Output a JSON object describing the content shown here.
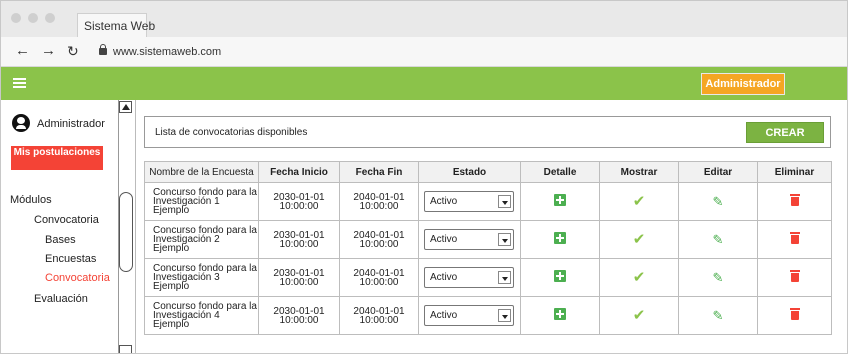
{
  "browser": {
    "tab_title": "Sistema Web",
    "url": "www.sistemaweb.com"
  },
  "header": {
    "admin_button": "Administrador"
  },
  "sidebar": {
    "user_name": "Administrador",
    "mis_postulaciones": "Mis postulaciones",
    "menu": {
      "modulos": "Módulos",
      "convocatoria": "Convocatoria",
      "bases": "Bases",
      "encuestas": "Encuestas",
      "convocatoria_active": "Convocatoria",
      "evaluacion": "Evaluación"
    }
  },
  "panel": {
    "title": "Lista de convocatorias disponibles",
    "crear_label": "CREAR"
  },
  "table": {
    "headers": [
      "Nombre de la Encuesta",
      "Fecha Inicio",
      "Fecha Fin",
      "Estado",
      "Detalle",
      "Mostrar",
      "Editar",
      "Eliminar"
    ],
    "rows": [
      {
        "name1": "Concurso fondo para la",
        "name2": "Investigación 1 Ejemplo",
        "inicio1": "2030-01-01",
        "inicio2": "10:00:00",
        "fin1": "2040-01-01",
        "fin2": "10:00:00",
        "estado": "Activo"
      },
      {
        "name1": "Concurso fondo para la",
        "name2": "Investigación 2 Ejemplo",
        "inicio1": "2030-01-01",
        "inicio2": "10:00:00",
        "fin1": "2040-01-01",
        "fin2": "10:00:00",
        "estado": "Activo"
      },
      {
        "name1": "Concurso fondo para la",
        "name2": "Investigación 3 Ejemplo",
        "inicio1": "2030-01-01",
        "inicio2": "10:00:00",
        "fin1": "2040-01-01",
        "fin2": "10:00:00",
        "estado": "Activo"
      },
      {
        "name1": "Concurso fondo para la",
        "name2": "Investigación 4 Ejemplo",
        "inicio1": "2030-01-01",
        "inicio2": "10:00:00",
        "fin1": "2040-01-01",
        "fin2": "10:00:00",
        "estado": "Activo"
      }
    ]
  },
  "colors": {
    "header_green": "#8bc34a",
    "admin_orange": "#f5a623",
    "danger_red": "#f44336",
    "crear_green": "#7cb342"
  },
  "icons": {
    "detalle": "add-box-icon",
    "mostrar": "check-icon",
    "editar": "pencil-icon",
    "eliminar": "trash-icon"
  }
}
